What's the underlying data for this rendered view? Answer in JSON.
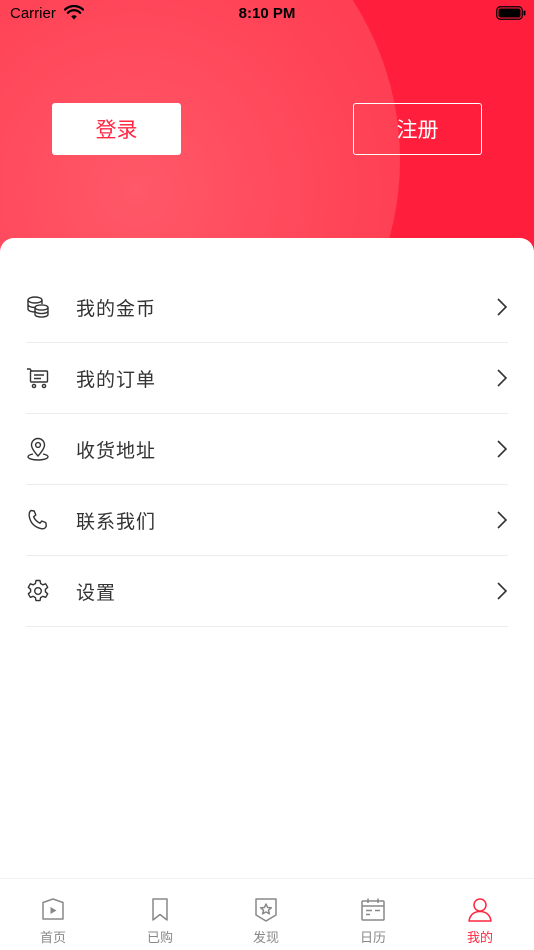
{
  "status_bar": {
    "carrier": "Carrier",
    "time": "8:10 PM"
  },
  "header": {
    "login_label": "登录",
    "register_label": "注册"
  },
  "menu": {
    "items": [
      {
        "label": "我的金币",
        "icon": "coins-icon"
      },
      {
        "label": "我的订单",
        "icon": "cart-icon"
      },
      {
        "label": "收货地址",
        "icon": "location-pin-icon"
      },
      {
        "label": "联系我们",
        "icon": "phone-icon"
      },
      {
        "label": "设置",
        "icon": "gear-icon"
      }
    ]
  },
  "tabbar": {
    "tabs": [
      {
        "label": "首页",
        "icon": "play-icon",
        "active": false
      },
      {
        "label": "已购",
        "icon": "bookmark-icon",
        "active": false
      },
      {
        "label": "发现",
        "icon": "star-badge-icon",
        "active": false
      },
      {
        "label": "日历",
        "icon": "calendar-icon",
        "active": false
      },
      {
        "label": "我的",
        "icon": "user-icon",
        "active": true
      }
    ]
  },
  "colors": {
    "brand": "#ff2741",
    "tab_inactive": "#888888",
    "text": "#333333"
  }
}
